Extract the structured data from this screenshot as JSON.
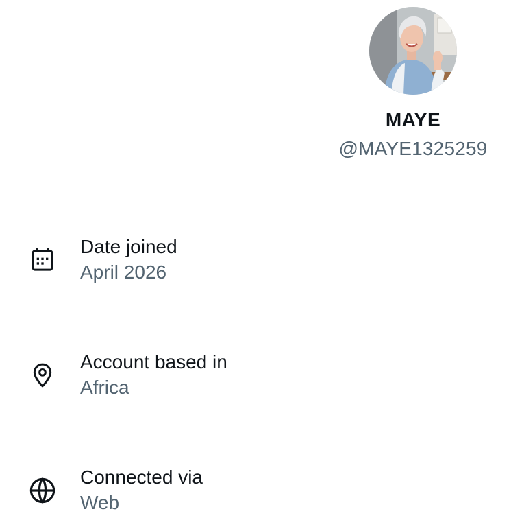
{
  "profile": {
    "display_name": "MAYE",
    "handle": "@MAYE1325259"
  },
  "info": {
    "joined": {
      "label": "Date joined",
      "value": "April 2026",
      "icon": "calendar-icon"
    },
    "based": {
      "label": "Account based in",
      "value": "Africa",
      "icon": "location-pin-icon"
    },
    "connected": {
      "label": "Connected via",
      "value": "Web",
      "icon": "globe-icon"
    }
  },
  "colors": {
    "primary_text": "#0f1419",
    "secondary_text": "#536471",
    "border": "#eff3f4"
  }
}
